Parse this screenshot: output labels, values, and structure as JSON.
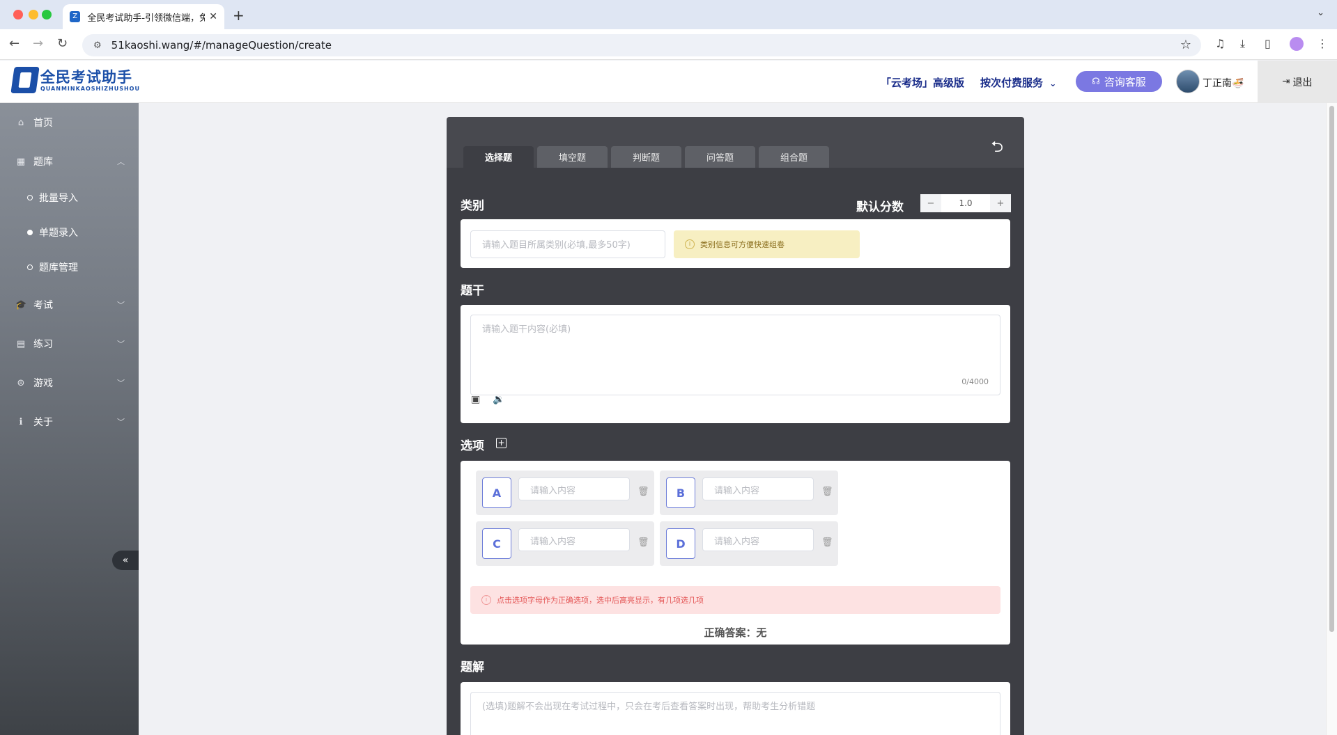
{
  "browser": {
    "tab_title": "全民考试助手-引领微信端，免费",
    "url": "51kaoshi.wang/#/manageQuestion/create"
  },
  "header": {
    "logo_title": "全民考试助手",
    "logo_sub": "QUANMINKAOSHIZHUSHOU",
    "cloud_link": "「云考场」高级版",
    "pay_link": "按次付费服务",
    "service_button": "咨询客服",
    "user_name": "丁正南🍜",
    "logout": "退出"
  },
  "sidebar": {
    "items": [
      {
        "label": "首页",
        "icon": "home-icon"
      },
      {
        "label": "题库",
        "icon": "grid-icon"
      },
      {
        "label": "考试",
        "icon": "graduation-cap-icon"
      },
      {
        "label": "练习",
        "icon": "book-icon"
      },
      {
        "label": "游戏",
        "icon": "gamepad-icon"
      },
      {
        "label": "关于",
        "icon": "info-icon"
      }
    ],
    "sub_items": [
      {
        "label": "批量导入"
      },
      {
        "label": "单题录入"
      },
      {
        "label": "题库管理"
      }
    ],
    "collapse_label": "«"
  },
  "form": {
    "question_tabs": [
      "选择题",
      "填空题",
      "判断题",
      "问答题",
      "组合题"
    ],
    "category_title": "类别",
    "default_score_label": "默认分数",
    "default_score_value": "1.0",
    "category_placeholder": "请输入题目所属类别(必填,最多50字)",
    "category_tip": "类别信息可方便快速组卷",
    "stem_title": "题干",
    "stem_placeholder": "请输入题干内容(必填)",
    "stem_counter": "0/4000",
    "options_title": "选项",
    "options": [
      {
        "letter": "A",
        "placeholder": "请输入内容"
      },
      {
        "letter": "B",
        "placeholder": "请输入内容"
      },
      {
        "letter": "C",
        "placeholder": "请输入内容"
      },
      {
        "letter": "D",
        "placeholder": "请输入内容"
      }
    ],
    "options_tip": "点击选项字母作为正确选项，选中后高亮显示，有几项选几项",
    "correct_answer": "正确答案：无",
    "explain_title": "题解",
    "explain_placeholder": "(选填)题解不会出现在考试过程中，只会在考后查看答案时出现，帮助考生分析错题"
  },
  "colors": {
    "accent": "#7b78e2",
    "brand": "#1b4fa8",
    "option_border": "#6e7ed9"
  }
}
